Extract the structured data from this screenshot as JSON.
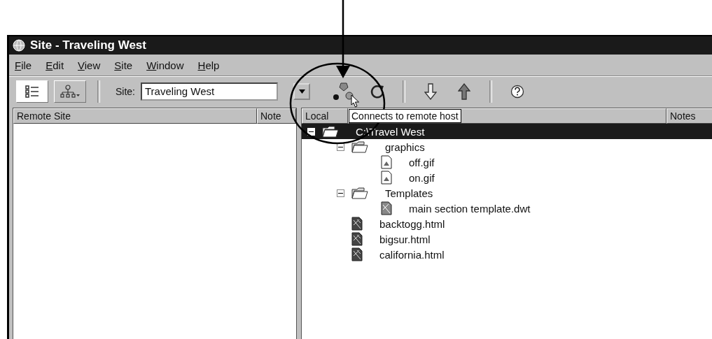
{
  "window": {
    "title": "Site - Traveling West"
  },
  "menu": [
    {
      "label": "File"
    },
    {
      "label": "Edit"
    },
    {
      "label": "View"
    },
    {
      "label": "Site"
    },
    {
      "label": "Window"
    },
    {
      "label": "Help"
    }
  ],
  "toolbar": {
    "view_buttons": [
      {
        "kind": "list",
        "selected": true
      },
      {
        "kind": "map",
        "selected": false
      }
    ],
    "site_label": "Site:",
    "site_value": "Traveling West",
    "tools": [
      {
        "kind": "connect"
      },
      {
        "kind": "refresh"
      },
      {
        "kind": "separator"
      },
      {
        "kind": "get"
      },
      {
        "kind": "put"
      },
      {
        "kind": "separator"
      },
      {
        "kind": "help"
      }
    ],
    "tooltip": "Connects to remote host"
  },
  "remote_pane": {
    "columns": [
      "Remote Site",
      "Note"
    ]
  },
  "local_pane": {
    "columns": [
      "Local",
      "Notes"
    ],
    "tree": [
      {
        "label": "C:\\Travel West",
        "kind": "drive",
        "expanded": true,
        "selected": true,
        "children": [
          {
            "label": "graphics",
            "kind": "folder",
            "expanded": true,
            "selected": false,
            "children": [
              {
                "label": "off.gif",
                "kind": "image",
                "selected": false
              },
              {
                "label": "on.gif",
                "kind": "image",
                "selected": false
              }
            ]
          },
          {
            "label": "Templates",
            "kind": "folder",
            "expanded": true,
            "selected": false,
            "children": [
              {
                "label": "main section template.dwt",
                "kind": "template",
                "selected": false
              }
            ]
          },
          {
            "label": "backtogg.html",
            "kind": "html",
            "selected": false
          },
          {
            "label": "bigsur.html",
            "kind": "html",
            "selected": false
          },
          {
            "label": "california.html",
            "kind": "html",
            "selected": false
          }
        ]
      }
    ]
  }
}
